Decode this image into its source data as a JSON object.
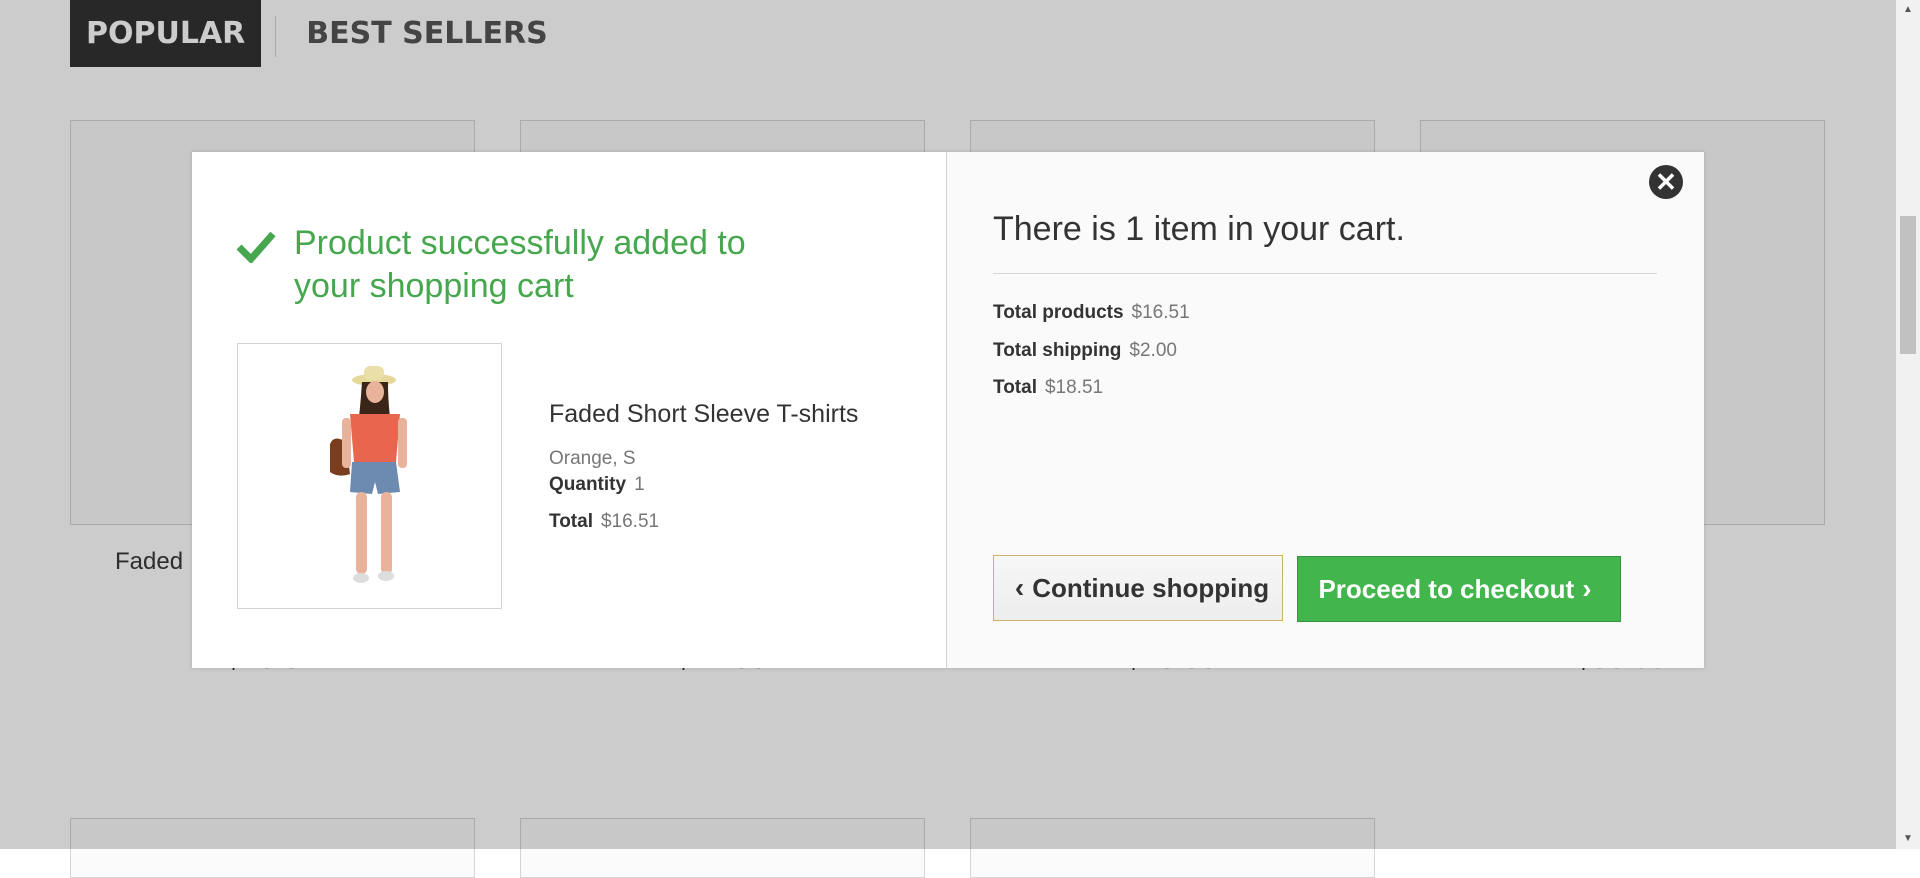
{
  "tabs": {
    "popular": "Popular",
    "best_sellers": "Best Sellers"
  },
  "background": {
    "cards": [
      {
        "name": "Faded",
        "price": "$16.51"
      },
      {
        "name": "",
        "price": "$27.00"
      },
      {
        "name": "",
        "price": "$26.00"
      },
      {
        "name": "",
        "price": "$50.99"
      }
    ]
  },
  "modal": {
    "success_title": "Product successfully added to your shopping cart",
    "product": {
      "name": "Faded Short Sleeve T-shirts",
      "attributes": "Orange, S",
      "quantity_label": "Quantity",
      "quantity": "1",
      "total_label": "Total",
      "total": "$16.51"
    },
    "cart": {
      "heading": "There is 1 item in your cart.",
      "total_products_label": "Total products",
      "total_products": "$16.51",
      "total_shipping_label": "Total shipping",
      "total_shipping": "$2.00",
      "total_label": "Total",
      "total": "$18.51"
    },
    "buttons": {
      "continue": "Continue shopping",
      "checkout": "Proceed to checkout"
    },
    "close_icon": "close-icon"
  },
  "colors": {
    "success": "#46a74e",
    "checkout": "#43b54d",
    "dark_tab": "#333333"
  }
}
